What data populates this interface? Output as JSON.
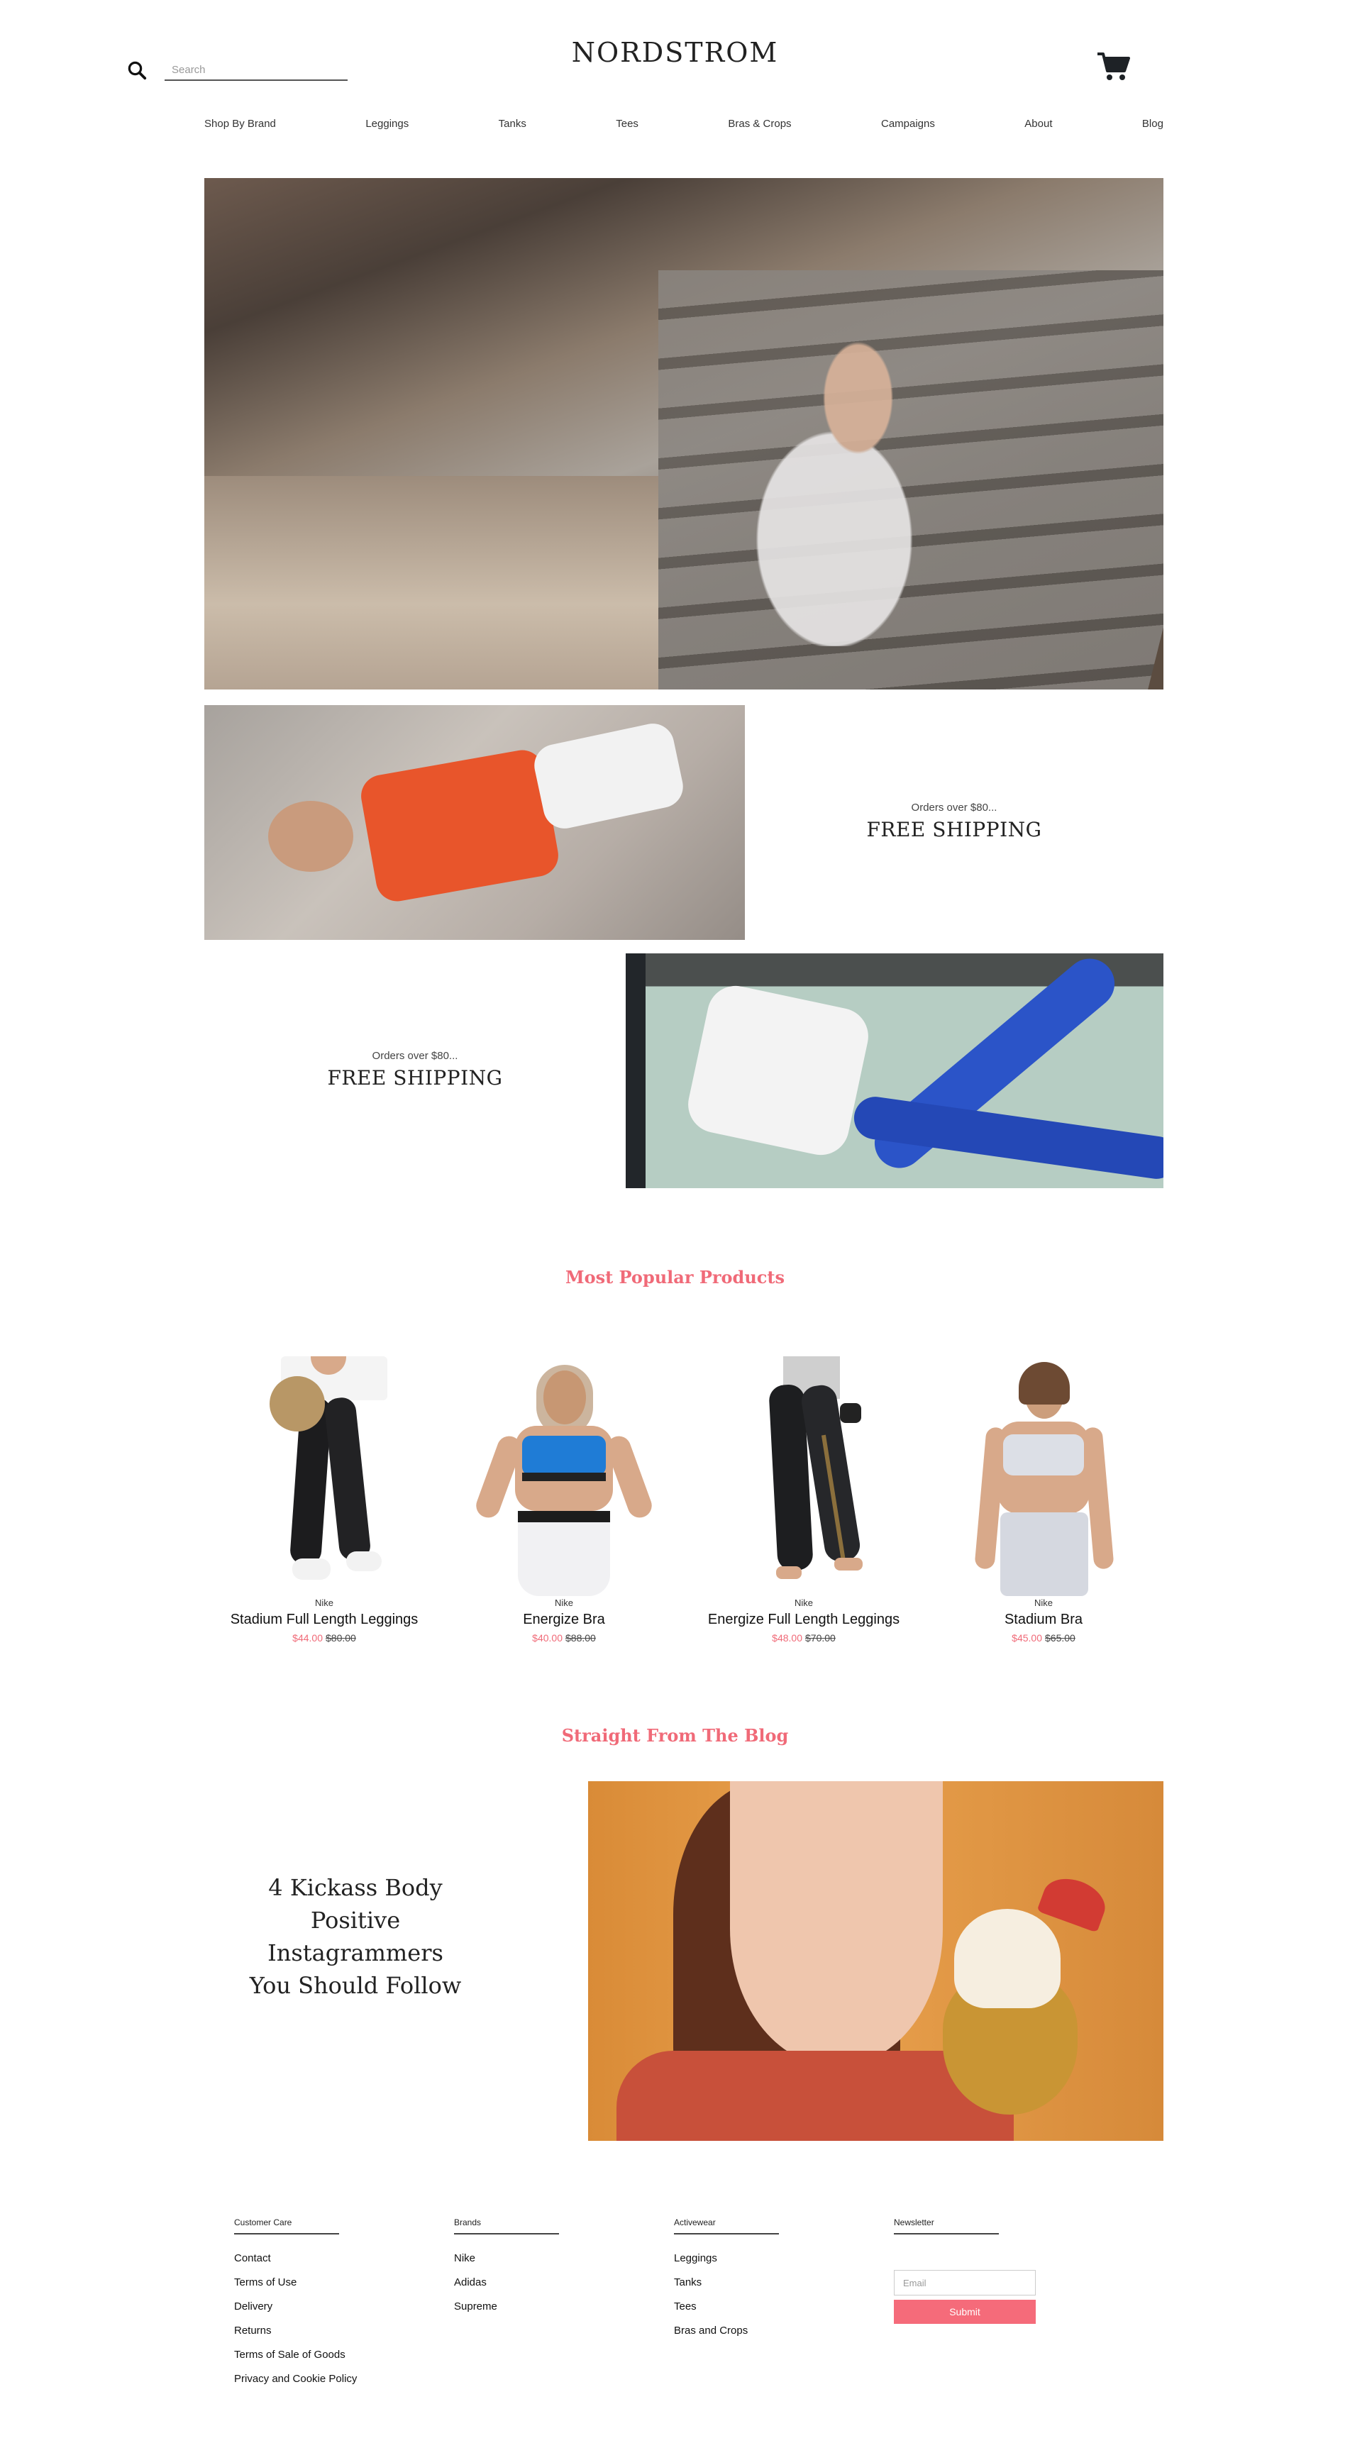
{
  "header": {
    "logo": "NORDSTROM",
    "search_placeholder": "Search"
  },
  "nav": {
    "items": [
      {
        "label": "Shop By Brand"
      },
      {
        "label": "Leggings"
      },
      {
        "label": "Tanks"
      },
      {
        "label": "Tees"
      },
      {
        "label": "Bras & Crops"
      },
      {
        "label": "Campaigns"
      },
      {
        "label": "About"
      },
      {
        "label": "Blog"
      }
    ]
  },
  "promos": [
    {
      "sub": "Orders over $80...",
      "main": "FREE SHIPPING"
    },
    {
      "sub": "Orders over $80...",
      "main": "FREE SHIPPING"
    }
  ],
  "popular": {
    "title": "Most Popular Products",
    "products": [
      {
        "brand": "Nike",
        "name": "Stadium Full Length Leggings",
        "sale_price": "$44.00",
        "old_price": "$80.00"
      },
      {
        "brand": "Nike",
        "name": "Energize Bra",
        "sale_price": "$40.00",
        "old_price": "$88.00"
      },
      {
        "brand": "Nike",
        "name": "Energize Full Length Leggings",
        "sale_price": "$48.00",
        "old_price": "$70.00"
      },
      {
        "brand": "Nike",
        "name": "Stadium Bra",
        "sale_price": "$45.00",
        "old_price": "$65.00"
      }
    ]
  },
  "blog": {
    "title": "Straight From The Blog",
    "heading_lines": [
      "4 Kickass Body",
      "Positive",
      "Instagrammers",
      "You Should Follow"
    ]
  },
  "footer": {
    "columns": [
      {
        "heading": "Customer Care",
        "links": [
          "Contact",
          "Terms of Use",
          "Delivery",
          "Returns",
          "Terms of Sale of Goods",
          "Privacy and Cookie Policy"
        ]
      },
      {
        "heading": "Brands",
        "links": [
          "Nike",
          "Adidas",
          "Supreme"
        ]
      },
      {
        "heading": "Activewear",
        "links": [
          "Leggings",
          "Tanks",
          "Tees",
          "Bras and Crops"
        ]
      }
    ],
    "newsletter": {
      "heading": "Newsletter",
      "email_placeholder": "Email",
      "submit_label": "Submit"
    }
  },
  "colors": {
    "accent": "#f06a78",
    "button": "#f56b7a"
  },
  "icons": {
    "search": "search-icon",
    "cart": "cart-icon"
  }
}
